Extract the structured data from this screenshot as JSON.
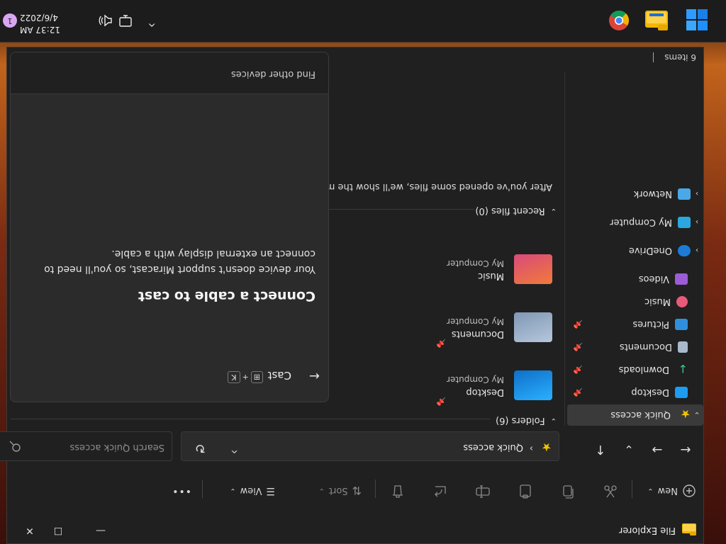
{
  "window": {
    "title": "File Explorer",
    "minimize_glyph": "—",
    "maximize_glyph": "☐",
    "close_glyph": "✕"
  },
  "toolbar": {
    "new_label": "New",
    "sort_label": "Sort",
    "view_label": "View",
    "more_glyph": "•••",
    "icons": [
      "cut-icon",
      "copy-icon",
      "paste-icon",
      "rename-icon",
      "share-icon",
      "delete-icon"
    ]
  },
  "navigation": {
    "back_glyph": "←",
    "forward_glyph": "→",
    "up_glyph": "↑",
    "recent_glyph": "⌄",
    "address_text": "Quick access",
    "breadcrumb_sep": "›",
    "refresh_glyph": "↻",
    "search_placeholder": "Search Quick access"
  },
  "sidebar": {
    "items": [
      {
        "label": "Quick access",
        "expandable": true,
        "selected": true,
        "color": "#f2c200"
      },
      {
        "label": "Desktop",
        "pinned": true,
        "color": "#1d9bf0"
      },
      {
        "label": "Downloads",
        "pinned": true,
        "color": "#3ccb8e"
      },
      {
        "label": "Documents",
        "pinned": true,
        "color": "#a9b8cc"
      },
      {
        "label": "Pictures",
        "pinned": true,
        "color": "#2f8fdc"
      },
      {
        "label": "Music",
        "color": "#e85a7a"
      },
      {
        "label": "Videos",
        "color": "#9c5cd6"
      },
      {
        "label": "OneDrive",
        "expandable": true,
        "color": "#1c7bd8"
      },
      {
        "label": "My Computer",
        "expandable": true,
        "color": "#2aa7e0"
      },
      {
        "label": "Network",
        "expandable": true,
        "color": "#4aa8e8"
      }
    ]
  },
  "main": {
    "folders_header": "Folders (6)",
    "folders": [
      {
        "name": "Desktop",
        "location": "My Computer",
        "pinned": true,
        "color": "#1d8fe0"
      },
      {
        "name": "Documents",
        "location": "My Computer",
        "pinned": true,
        "color": "#8fa7c2"
      },
      {
        "name": "Music",
        "location": "My Computer",
        "pinned": false,
        "color": "#e0603a"
      }
    ],
    "recent_header": "Recent files (0)",
    "recent_empty_text": "After you've opened some files, we'll show the most recent ones here."
  },
  "status": {
    "items_count": "6 items"
  },
  "cast": {
    "back_glyph": "←",
    "title": "Cast",
    "shortcut_key": "K",
    "heading": "Connect a cable to cast",
    "body": "Your device doesn't support Miracast, so you'll need to connect an external display with a cable.",
    "footer_link": "Find other devices"
  },
  "taskbar": {
    "time": "12:37 AM",
    "date": "4/6/2022",
    "chevron_glyph": "^",
    "notification_count": "1"
  }
}
